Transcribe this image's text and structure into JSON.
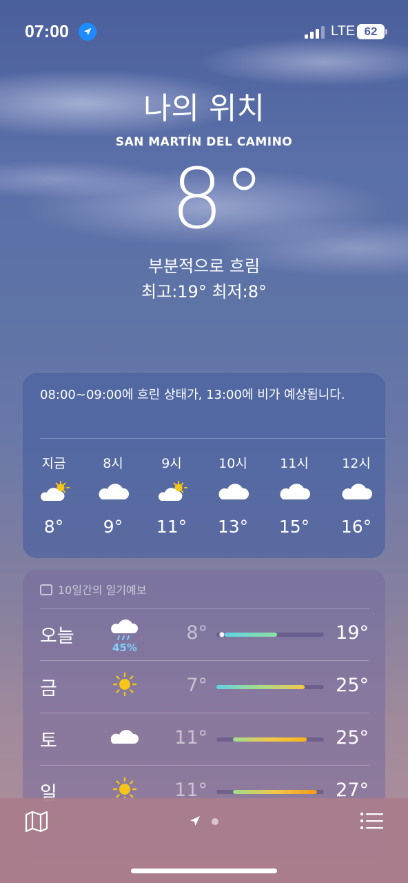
{
  "status_bar": {
    "time": "07:00",
    "network": "LTE",
    "battery": "62"
  },
  "header": {
    "title": "나의 위치",
    "place": "SAN MARTÍN DEL CAMINO",
    "temperature": "8°",
    "condition": "부분적으로 흐림",
    "high_low": "최고:19°  최저:8°"
  },
  "hourly": {
    "summary": "08:00~09:00에 흐린 상태가, 13:00에 비가 예상됩니다.",
    "items": [
      {
        "label": "지금",
        "icon": "partly-cloudy-icon",
        "temp": "8°"
      },
      {
        "label": "8시",
        "icon": "cloud-icon",
        "temp": "9°"
      },
      {
        "label": "9시",
        "icon": "partly-cloudy-icon",
        "temp": "11°"
      },
      {
        "label": "10시",
        "icon": "cloud-icon",
        "temp": "13°"
      },
      {
        "label": "11시",
        "icon": "cloud-icon",
        "temp": "15°"
      },
      {
        "label": "12시",
        "icon": "cloud-icon",
        "temp": "16°"
      }
    ]
  },
  "daily": {
    "header": "10일간의 일기예보",
    "days": [
      {
        "day": "오늘",
        "icon": "rain-cloud-icon",
        "precip": "45%",
        "low": "8°",
        "high": "19°"
      },
      {
        "day": "금",
        "icon": "sun-icon",
        "precip": "",
        "low": "7°",
        "high": "25°"
      },
      {
        "day": "토",
        "icon": "cloud-icon",
        "precip": "",
        "low": "11°",
        "high": "25°"
      },
      {
        "day": "일",
        "icon": "sun-icon",
        "precip": "",
        "low": "11°",
        "high": "27°"
      }
    ]
  },
  "tab_bar": {
    "map_icon": "map-icon",
    "location_icon": "location-arrow-icon",
    "list_icon": "list-icon"
  },
  "colors": {
    "sun": "#f5c518",
    "precip": "#7fd0ff",
    "location_badge": "#1e8cff"
  }
}
